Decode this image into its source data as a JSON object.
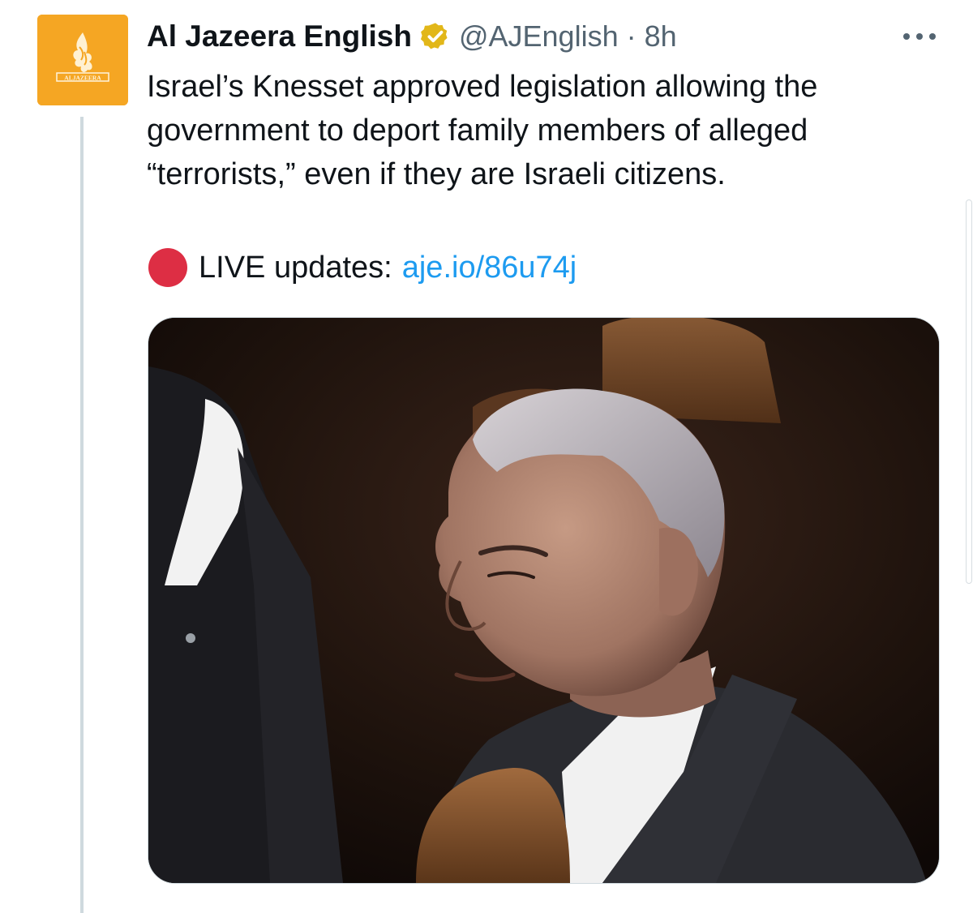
{
  "author": {
    "name": "Al Jazeera English",
    "handle": "@AJEnglish",
    "separator": "·",
    "time": "8h",
    "verified": true,
    "avatar_logo_text": "ALJAZEERA",
    "brand_color": "#f5a623",
    "badge_color": "#e2b719"
  },
  "tweet": {
    "text": "Israel’s Knesset approved legislation allowing the government to deport family members of alleged “terrorists,” even if they are Israeli citizens.",
    "live_label": "LIVE updates:",
    "live_link": "aje.io/86u74j",
    "link_color": "#1d9bf0",
    "live_dot_color": "#dd2e44"
  },
  "menu": {
    "icon": "more-horizontal-icon"
  },
  "media": {
    "kind": "photo"
  }
}
